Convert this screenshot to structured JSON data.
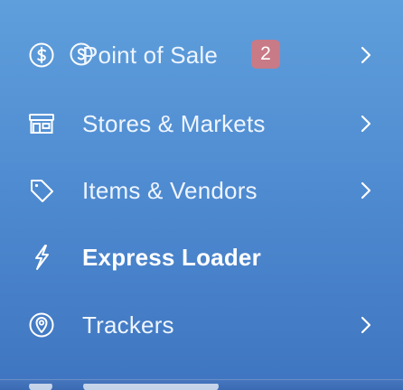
{
  "menu": {
    "items": [
      {
        "icon": "dollar-circle-icon",
        "label": "Point of Sale",
        "badge": "2",
        "has_chevron": true,
        "active": false
      },
      {
        "icon": "store-front-icon",
        "label": "Stores & Markets",
        "has_chevron": true,
        "active": false
      },
      {
        "icon": "tag-icon",
        "label": "Items & Vendors",
        "has_chevron": true,
        "active": false
      },
      {
        "icon": "lightning-bolt-icon",
        "label": "Express Loader",
        "has_chevron": false,
        "active": true
      },
      {
        "icon": "location-pin-icon",
        "label": "Trackers",
        "has_chevron": true,
        "active": false
      }
    ]
  },
  "colors": {
    "background_top": "#5f9fdc",
    "background_bottom": "#3f75c0",
    "badge": "#c87a86",
    "text": "#ffffff"
  }
}
